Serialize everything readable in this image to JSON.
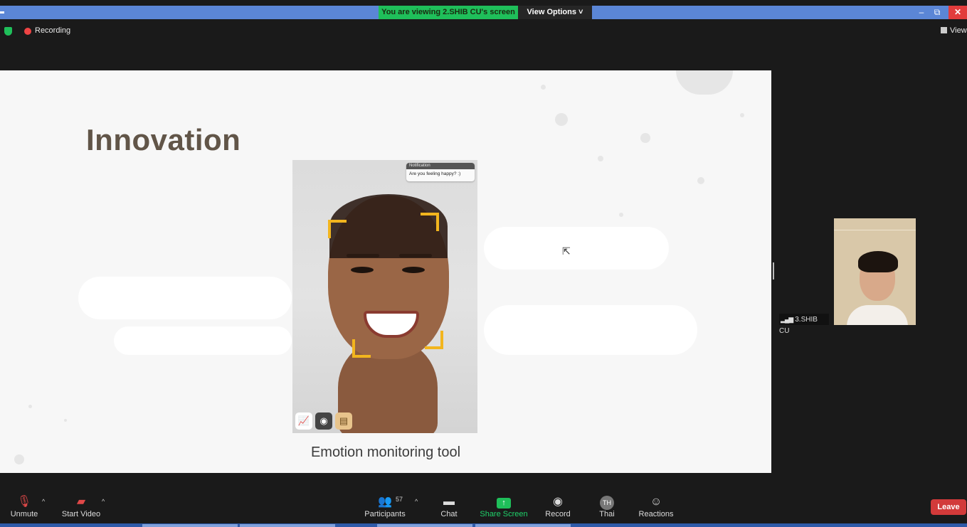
{
  "top_bar": {
    "viewing_banner": "You are viewing 2.SHIB CU's screen",
    "view_options": "View Options ˅",
    "min_glyph": "–",
    "restore_glyph": "⧉",
    "close_glyph": "✕"
  },
  "status_row": {
    "recording_label": "Recording",
    "view_label": "View"
  },
  "slide": {
    "title": "Innovation",
    "notification_header": "Notification",
    "notification_text": "Are you feeling happy? :)",
    "caption": "Emotion monitoring tool"
  },
  "video_tile": {
    "name": "3.SHIB CU"
  },
  "toolbar": {
    "unmute_label": "Unmute",
    "start_video_label": "Start Video",
    "participants_label": "Participants",
    "participants_count": "57",
    "chat_label": "Chat",
    "share_screen_label": "Share Screen",
    "record_label": "Record",
    "thai_label": "Thai",
    "thai_initials": "TH",
    "reactions_label": "Reactions",
    "leave_label": "Leave"
  },
  "colors": {
    "banner_green": "#1fbf5a",
    "titlebar_blue": "#5b86d6",
    "leave_red": "#d23a3a",
    "slide_title_brown": "#615548"
  },
  "icons": [
    "shield-icon",
    "record-dot-icon",
    "grid-view-icon",
    "mic-muted-icon",
    "video-off-icon",
    "participants-icon",
    "chat-icon",
    "share-screen-icon",
    "record-icon",
    "language-avatar-icon",
    "reactions-icon",
    "cursor-icon"
  ]
}
